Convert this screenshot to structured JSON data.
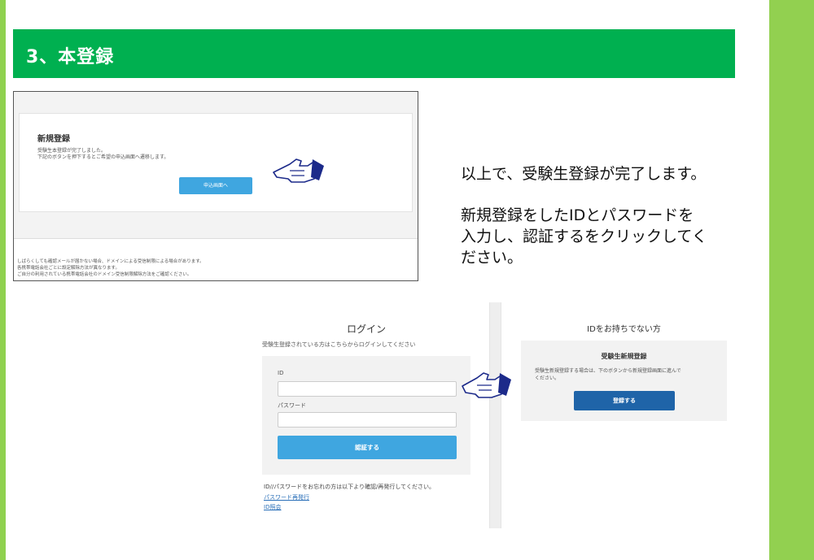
{
  "section": {
    "title": "3、本登録",
    "banner_color": "#00b050",
    "side_color": "#92d050"
  },
  "screenshot_complete": {
    "heading": "新規登録",
    "message_lines": [
      "受験生本登録が完了しました。",
      "下記のボタンを押下するとご希望の申込画面へ遷移します。"
    ],
    "button_label": "申込画面へ",
    "notes": [
      "しばらくしても確認メールが届かない場合、ドメインによる受信制限による場合があります。",
      "各携帯電話会社ごとに設定解除方法が異なります。",
      "ご自分の利用されている携帯電話会社のドメイン受信制限解除方法をご確認ください。"
    ]
  },
  "instructions": {
    "line1": "以上で、受験生登録が完了します。",
    "line2": "新規登録をしたIDとパスワードを",
    "line3": "入力し、認証するをクリックしてく",
    "line4": "ださい。"
  },
  "login": {
    "title": "ログイン",
    "subtitle": "受験生登録されている方はこちらからログインしてください",
    "id_label": "ID",
    "id_value": "",
    "password_label": "パスワード",
    "password_value": "",
    "submit_label": "認証する",
    "forgot_text": "ID//パスワードをお忘れの方は以下より確認/再発行してください。",
    "link_password": "パスワード再発行",
    "link_id": "ID照会"
  },
  "no_id": {
    "title": "IDをお持ちでない方",
    "heading": "受験生新規登録",
    "desc_lines": [
      "受験生新規登録する場合は、下のボタンから新規登録画面に進んで",
      "ください。"
    ],
    "button_label": "登録する"
  },
  "icons": {
    "pointer": "pointing-hand-icon"
  },
  "colors": {
    "primary_button": "#3fa6e0",
    "dark_button": "#1f64a8",
    "link": "#2a6fb8"
  }
}
